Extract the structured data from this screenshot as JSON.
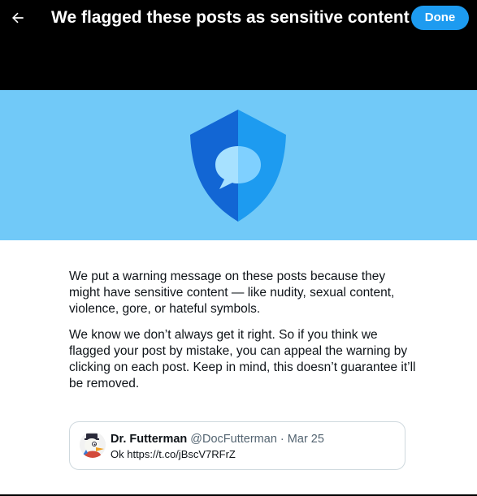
{
  "header": {
    "title": "We flagged these posts as sensitive content",
    "back_icon": "arrow-left-icon",
    "done_label": "Done"
  },
  "banner": {
    "illustration": "shield-with-speech-bubble-icon",
    "colors": {
      "background": "#71c9f8",
      "shield_dark": "#1266d4",
      "shield_light": "#1d9bf0",
      "bubble": "#a7e1ff"
    }
  },
  "body": {
    "paragraph_1": "We put a warning message on these posts because they might have sensitive content — like nudity, sexual content, violence, gore, or hateful symbols.",
    "paragraph_2": "We know we don’t always get it right. So if you think we flagged your post by mistake, you can appeal the warning by clicking on each post. Keep in mind, this doesn’t guarantee it’ll be removed."
  },
  "post": {
    "name": "Dr. Futterman",
    "handle": "@DocFutterman",
    "separator": "·",
    "date": "Mar 25",
    "text": "Ok https://t.co/jBscV7RFrZ",
    "avatar_icon": "duck-avatar-icon"
  },
  "colors": {
    "accent": "#1d9bf0",
    "header_bg": "#000000",
    "text_primary": "#0f1419",
    "text_secondary": "#536471"
  }
}
